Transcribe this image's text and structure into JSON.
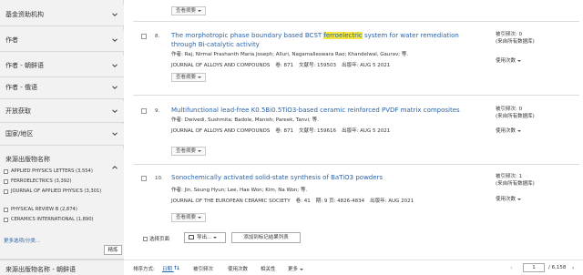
{
  "sidebar": {
    "facets": [
      {
        "label": "基金资助机构"
      },
      {
        "label": "作者"
      },
      {
        "label": "作者 - 朝鲜语"
      },
      {
        "label": "作者 - 俄语"
      },
      {
        "label": "开放获取"
      },
      {
        "label": "国家/地区"
      }
    ],
    "source_facet": {
      "label": "来源出版物名称",
      "items": [
        {
          "label": "APPLIED PHYSICS LETTERS (3,554)"
        },
        {
          "label": "FERROELECTRICS (3,392)"
        },
        {
          "label": "JOURNAL OF APPLIED PHYSICS (3,301)"
        },
        {
          "label": "PHYSICAL REVIEW B (2,874)"
        },
        {
          "label": "CERAMICS INTERNATIONAL (1,890)"
        }
      ],
      "more_label": "更多选项/分类...",
      "refine_label": "精炼"
    },
    "bottom_facet": {
      "label": "来源出版物名称 - 朝鲜语"
    }
  },
  "results": {
    "abstract_label": "查看摘要",
    "records": [
      {
        "num": "8.",
        "title_before": "The morphotropic phase boundary based BCST ",
        "title_highlight": "ferroelectric",
        "title_after": " system for water remediation through Bi-catalytic activity",
        "authors": "作者: Raj, Nirmal Prashanth Maria Joseph; Alluri, Nagamalleswara Rao; Khandelwal, Gaurav; 等.",
        "journal": "JOURNAL OF ALLOYS AND COMPOUNDS",
        "volume": "卷: 871",
        "article": "文献号: 159503",
        "date": "出版年: AUG 5 2021",
        "cite_count": "被引频次: 0",
        "cite_note": "(来自所有数据库)",
        "usage_label": "使用次数"
      },
      {
        "num": "9.",
        "title_before": "Multifunctional lead-free K0.5Bi0.5TiO3-based ceramic reinforced PVDF matrix composites",
        "title_highlight": "",
        "title_after": "",
        "authors": "作者: Dwivedi, Sushmita; Badole, Manish; Pareek, Tanvi; 等.",
        "journal": "JOURNAL OF ALLOYS AND COMPOUNDS",
        "volume": "卷: 871",
        "article": "文献号: 159616",
        "date": "出版年: AUG 5 2021",
        "cite_count": "被引频次: 0",
        "cite_note": "(来自所有数据库)",
        "usage_label": "使用次数"
      },
      {
        "num": "10.",
        "title_before": "Sonochemically activated solid-state synthesis of BaTiO3 powders",
        "title_highlight": "",
        "title_after": "",
        "authors": "作者: Jin, Seung Hyun; Lee, Hae Won; Kim, Na Won; 等.",
        "journal": "JOURNAL OF THE EUROPEAN CERAMIC SOCIETY",
        "volume": "卷: 41",
        "article": "期: 9  页: 4826-4834",
        "date": "出版年: AUG 2021",
        "cite_count": "被引频次: 1",
        "cite_note": "(来自所有数据库)",
        "usage_label": "使用次数"
      }
    ]
  },
  "toolbar": {
    "select_page": "选择页面",
    "export": "导出...",
    "add_marked": "添加到标记结果列表"
  },
  "sort": {
    "label": "排序方式:",
    "options": [
      {
        "label": "日期"
      },
      {
        "label": "被引频次"
      },
      {
        "label": "使用次数"
      },
      {
        "label": "相关性"
      },
      {
        "label": "更多"
      }
    ],
    "page_current": "1",
    "page_total": "/ 6,158"
  }
}
